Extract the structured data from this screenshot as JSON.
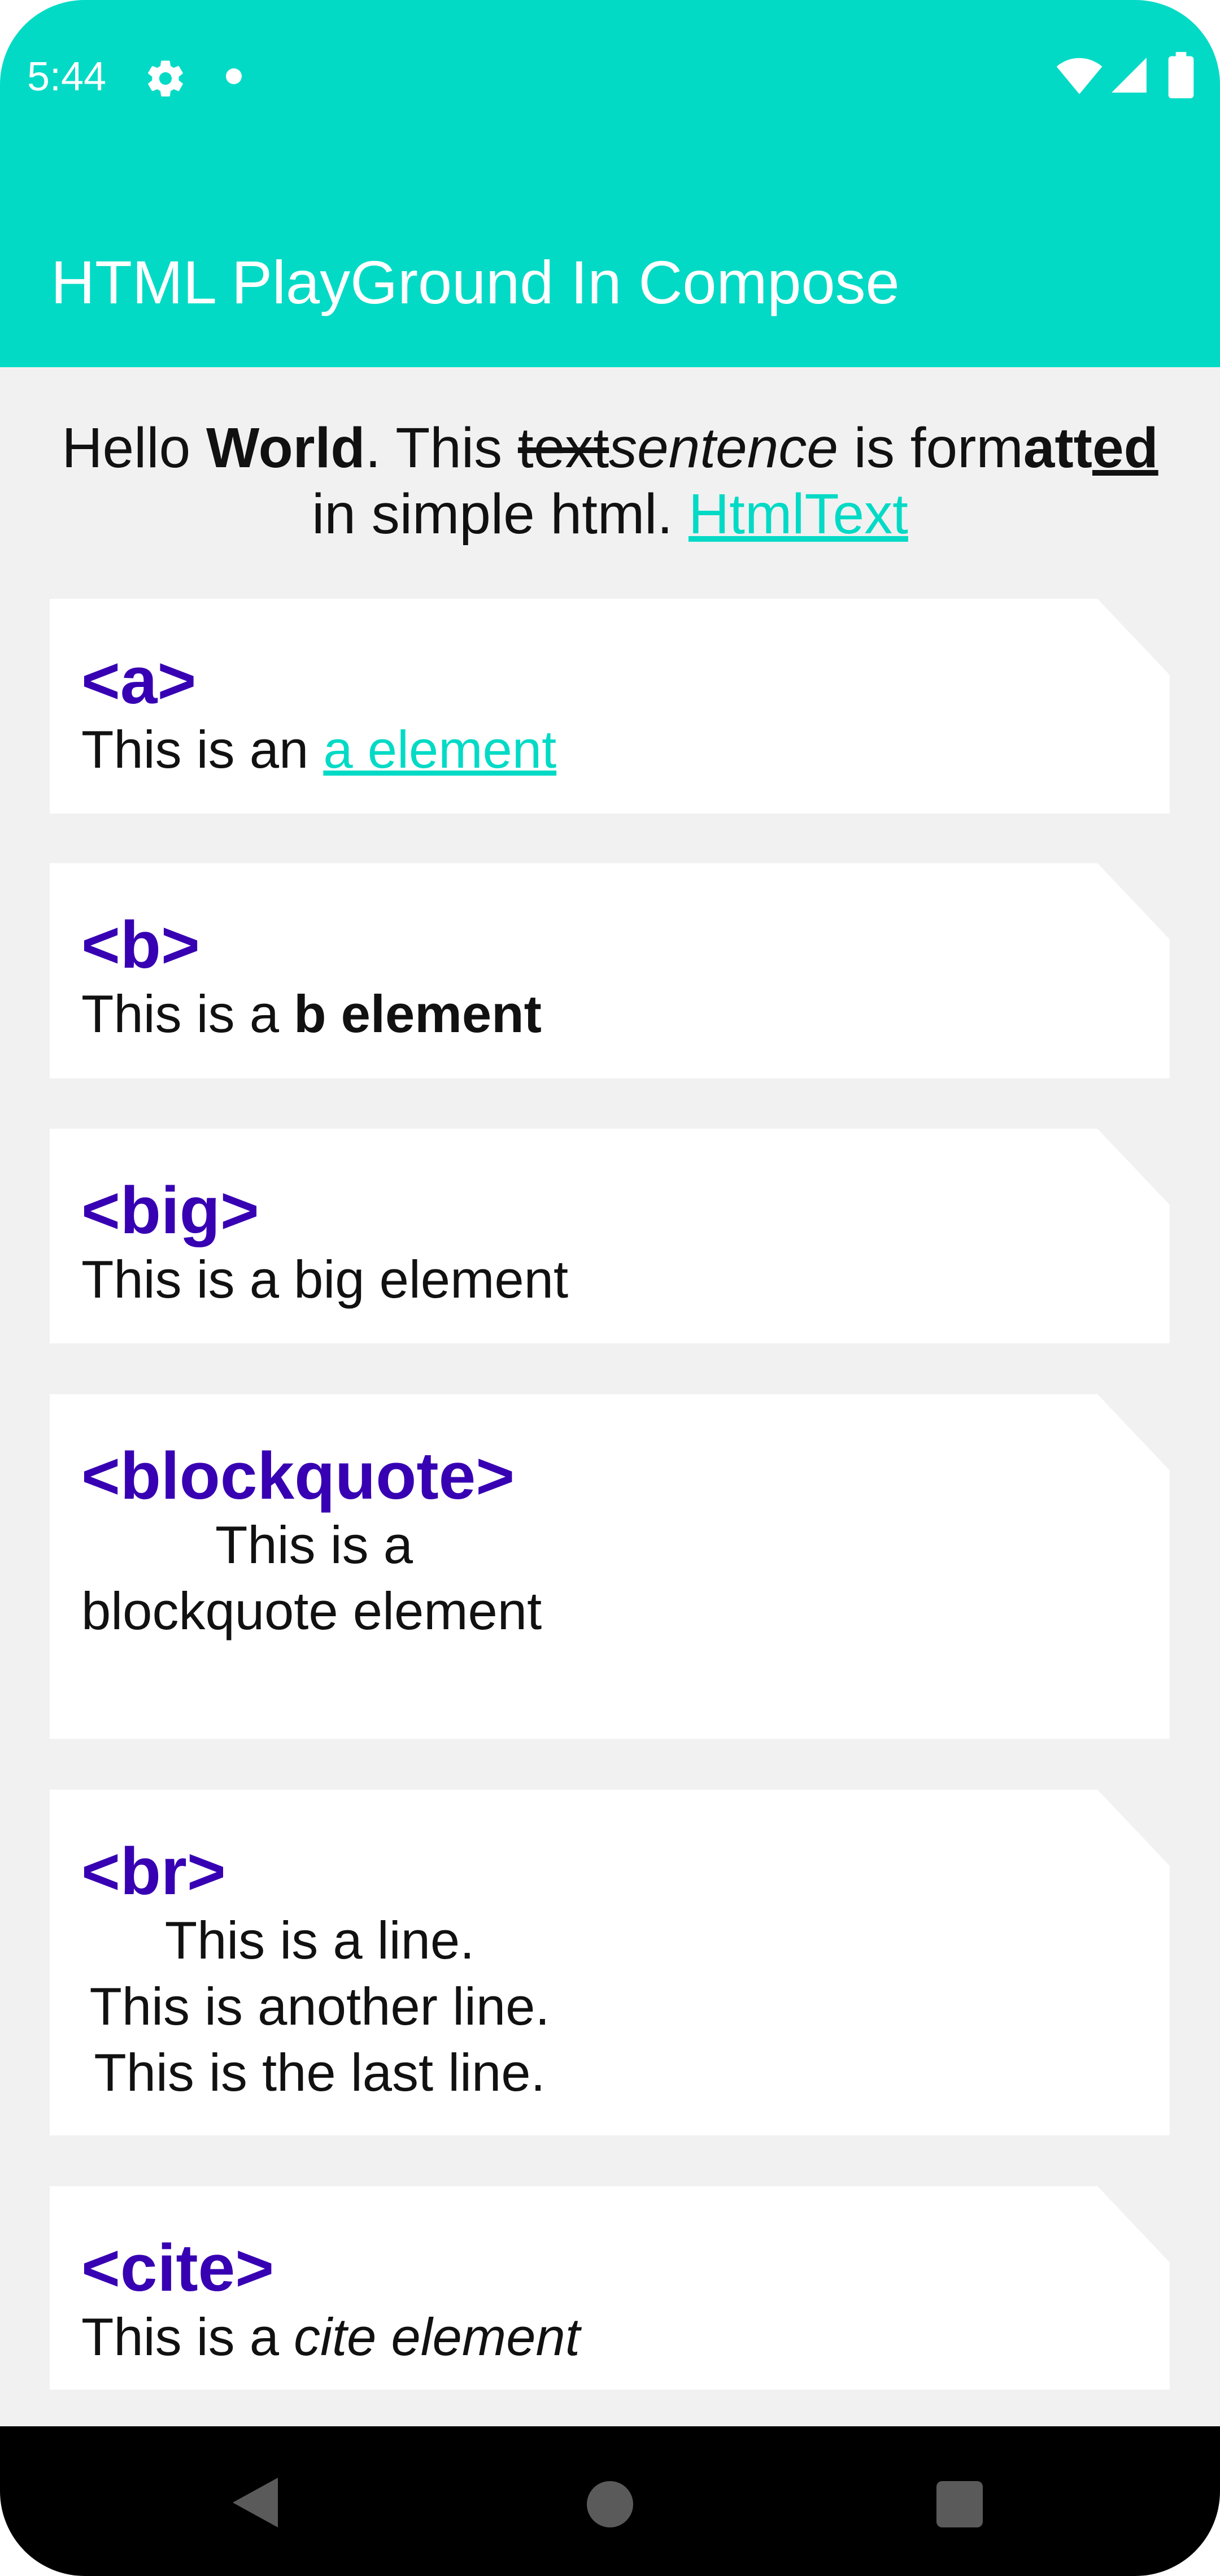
{
  "status_bar": {
    "time": "5:44",
    "icons": [
      "gear-icon",
      "notification-dot-icon",
      "wifi-icon",
      "signal-icon",
      "battery-icon"
    ]
  },
  "app_bar": {
    "title": "HTML PlayGround In Compose",
    "color": "#03dac5"
  },
  "intro": {
    "t1": "Hello ",
    "t2": "World",
    "t3": ". This ",
    "t4_strike": "text",
    "t5_italic": "sentence",
    "t6": " is form",
    "t7_bold": "att",
    "t8_bold_underline": "ed",
    "t9": " in simple html. ",
    "link": "HtmlText"
  },
  "cards": [
    {
      "title": "<a>",
      "pre": "This is an ",
      "link": "a element"
    },
    {
      "title": "<b>",
      "pre": "This is a ",
      "bold": "b element"
    },
    {
      "title": "<big>",
      "text": "This is a big element"
    },
    {
      "title": "<blockquote>",
      "line1": "This is a",
      "line2": "blockquote element"
    },
    {
      "title": "<br>",
      "line1": "This is a line.",
      "line2": "This is another line.",
      "line3": "This is the last line."
    },
    {
      "title": "<cite>",
      "pre": "This is a ",
      "italic": "cite element"
    }
  ],
  "colors": {
    "accent": "#03dac5",
    "tag_title": "#3700b3",
    "background": "#f1f1f1"
  },
  "nav_bar": {
    "icons": [
      "back-icon",
      "home-icon",
      "recents-icon"
    ]
  }
}
